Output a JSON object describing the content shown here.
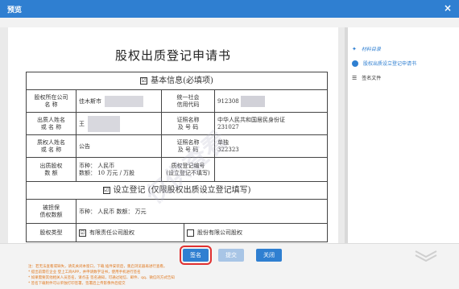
{
  "window": {
    "title": "预览",
    "close_label": "×"
  },
  "document": {
    "title": "股权出质登记申请书",
    "section1_title": "基本信息(必填项)",
    "section1_check": "☑",
    "rows": {
      "equity_company_label": "股权所在公司\n名        称",
      "equity_company_value": "佳木斯市",
      "credit_code_label": "统一社会\n信用代码",
      "credit_code_value": "912308",
      "pledgor_name_label": "出质人姓名\n或   名   称",
      "pledgor_name_value": "王",
      "pledgor_id_label": "证照名称\n及 号 码",
      "pledgor_id_value": "中华人民共和国居民身份证\n231027",
      "pledgee_name_label": "质权人姓名\n或   名   称",
      "pledgee_name_value": "公告",
      "pledgee_id_label": "证照名称\n及 号 码",
      "pledgee_id_value": "单独\n322323",
      "amount_label": "出质股权\n数        额",
      "amount_currency": "币种：  人民币",
      "amount_value": "数额：  10 万元 / 万股",
      "reg_no_label": "质权登记编号\n(设立登记不填写)"
    },
    "section2_title": "设立登记 (仅限股权出质设立登记填写)",
    "section2_check": "☑",
    "guarantee_label": "被担保\n债权数额",
    "guarantee_value": "币种：  人民币    数额：  万元",
    "equity_type_label": "股权类型",
    "equity_type_opt1": "有限责任公司股权",
    "equity_type_opt2": "股份有限公司股权",
    "watermark": "仅供查看"
  },
  "sidebar": {
    "heading": "材料目录",
    "items": [
      {
        "label": "股权出质设立登记申请书"
      },
      {
        "label": "签名文件"
      }
    ]
  },
  "footer": {
    "sign_label": "签名",
    "submit_label": "提交",
    "close_label": "关闭",
    "notes": [
      "注：若无法查看或缺失，请先关闭本窗口，下载 插件安装后，重启浏览器再进行查看。",
      "* 提出前需在企业 登上工商APP，并申请数字证书，使用手机进行签名",
      "* 如果需要其他相关人员签名，请点击 签名通知，可通过短信、邮件、qq、微信的方式告知",
      "* 签名下载附件可以单独打印签署，签署后上传影像件后提交"
    ]
  },
  "colors": {
    "primary": "#2f7fd1",
    "highlight": "#e03030",
    "note": "#e07a22"
  }
}
